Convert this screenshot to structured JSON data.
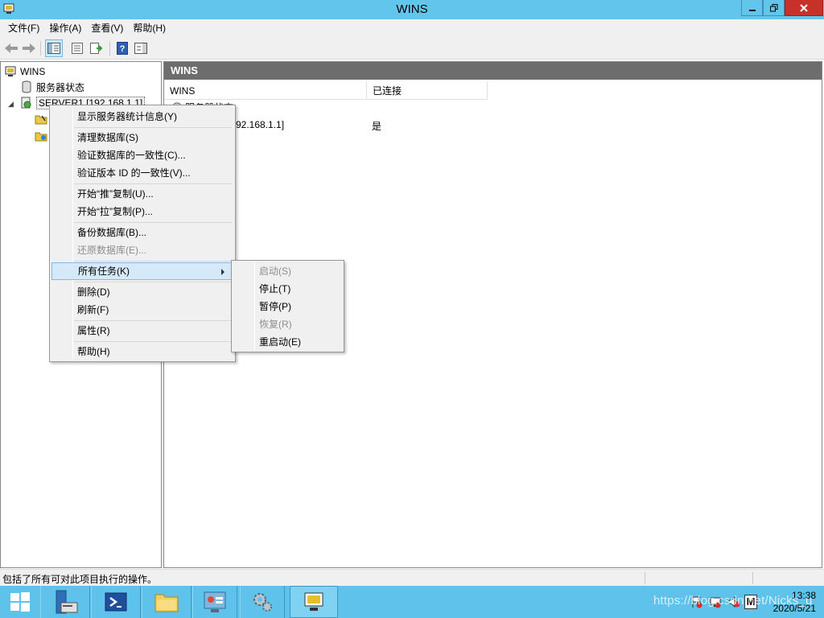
{
  "window": {
    "title": "WINS"
  },
  "menubar": [
    "文件(F)",
    "操作(A)",
    "查看(V)",
    "帮助(H)"
  ],
  "tree": {
    "root": "WINS",
    "server_status": "服务器状态",
    "server": "SERVER1 [192.168.1.1]"
  },
  "right_pane": {
    "header": "WINS",
    "columns": [
      "WINS",
      "已连接"
    ],
    "rows": [
      {
        "name": "服务器状态",
        "connected": ""
      },
      {
        "name": "SERVER1 [192.168.1.1]",
        "connected": "是"
      }
    ],
    "visible_row_name": "92.168.1.1]",
    "visible_partial_row": "服务器状态"
  },
  "context_menu": {
    "items": [
      {
        "label": "显示服务器统计信息(Y)",
        "disabled": false
      },
      {
        "label": "清理数据库(S)",
        "disabled": false
      },
      {
        "label": "验证数据库的一致性(C)...",
        "disabled": false
      },
      {
        "label": "验证版本 ID 的一致性(V)...",
        "disabled": false
      },
      {
        "label": "开始“推”复制(U)...",
        "disabled": false
      },
      {
        "label": "开始“拉”复制(P)...",
        "disabled": false
      },
      {
        "label": "备份数据库(B)...",
        "disabled": false
      },
      {
        "label": "还原数据库(E)...",
        "disabled": true
      },
      {
        "label": "所有任务(K)",
        "disabled": false,
        "highlighted": true,
        "submenu": true
      },
      {
        "label": "删除(D)",
        "disabled": false
      },
      {
        "label": "刷新(F)",
        "disabled": false
      },
      {
        "label": "属性(R)",
        "disabled": false
      },
      {
        "label": "帮助(H)",
        "disabled": false
      }
    ]
  },
  "submenu": {
    "items": [
      {
        "label": "启动(S)",
        "disabled": true
      },
      {
        "label": "停止(T)",
        "disabled": false
      },
      {
        "label": "暂停(P)",
        "disabled": false
      },
      {
        "label": "恢复(R)",
        "disabled": true
      },
      {
        "label": "重启动(E)",
        "disabled": false
      }
    ]
  },
  "statusbar": {
    "text": "包括了所有可对此项目执行的操作。"
  },
  "taskbar": {
    "clock_time": "13:38",
    "clock_date": "2020/5/21",
    "watermark": "https://blog.csdn.net/Nicks_u",
    "ime": "M"
  },
  "colors": {
    "titlebar": "#62c6ec",
    "taskbar": "#5ec2ea",
    "close_button": "#c7312a",
    "right_header": "#6d6d6d",
    "menu_highlight": "#d5e9f8"
  }
}
